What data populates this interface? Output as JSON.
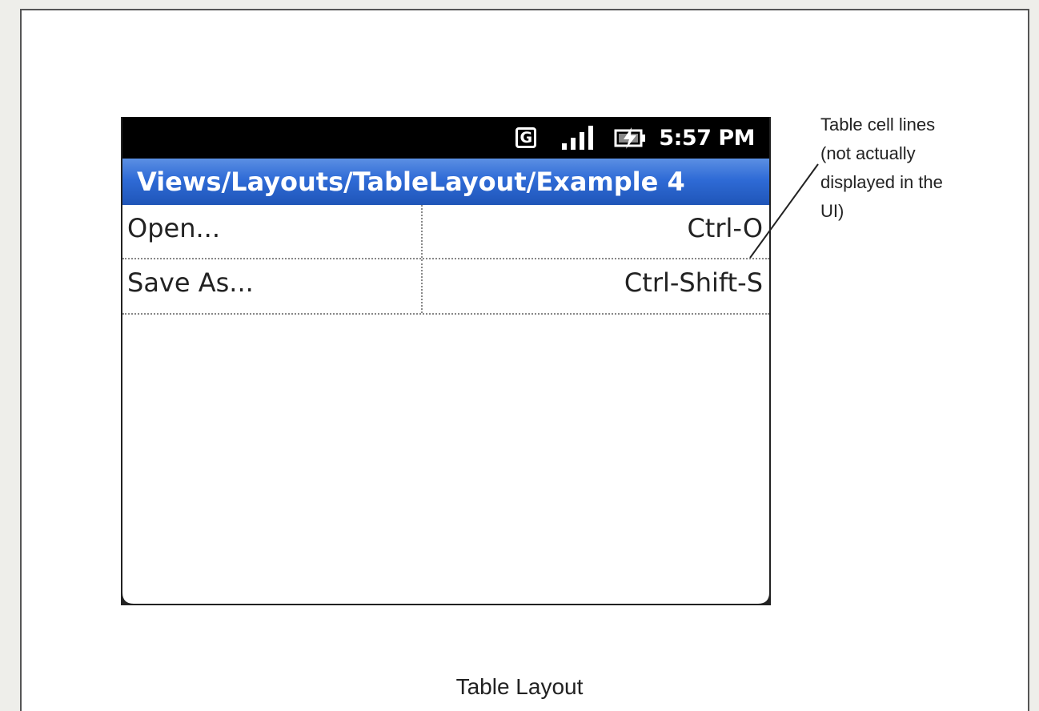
{
  "status_bar": {
    "network_label": "G",
    "signal_icon": "signal-bars-icon",
    "battery_icon": "battery-charging-icon",
    "time": "5:57 PM"
  },
  "title_bar": {
    "title": "Views/Layouts/TableLayout/Example 4"
  },
  "table": {
    "rows": [
      {
        "label": "Open...",
        "shortcut": "Ctrl-O"
      },
      {
        "label": "Save As...",
        "shortcut": "Ctrl-Shift-S"
      }
    ]
  },
  "annotation": {
    "line1": "Table cell lines",
    "line2": "(not actually",
    "line3": "displayed in the",
    "line4": "UI)"
  },
  "caption": "Table Layout",
  "colors": {
    "title_bar_blue": "#2f6bd6",
    "status_bar": "#000000"
  }
}
